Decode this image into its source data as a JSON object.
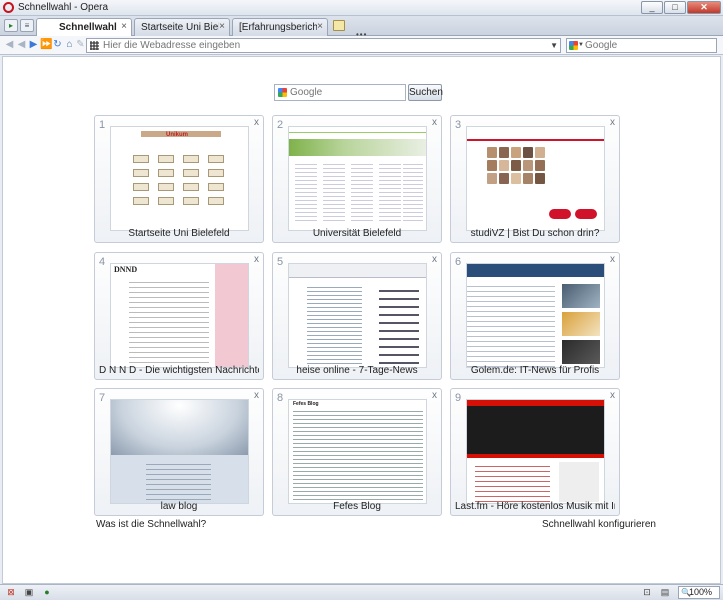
{
  "window": {
    "title": "Schnellwahl - Opera",
    "buttons": {
      "minimize": "_",
      "maximize": "□",
      "close": "✕"
    }
  },
  "tabs": [
    {
      "label": "Schnellwahl",
      "active": true
    },
    {
      "label": "Startseite Uni Bielefeld",
      "active": false
    },
    {
      "label": "[Erfahrungsbericht] Wel...",
      "active": false
    }
  ],
  "tab_close_glyph": "×",
  "tab_dots": "•••",
  "navigation": {
    "address_placeholder": "Hier die Webadresse eingeben",
    "search_engine_placeholder": "Google"
  },
  "speed_dial": {
    "search_placeholder": "Google",
    "search_button": "Suchen",
    "close_glyph": "x",
    "dials": [
      {
        "number": "1",
        "label": "Startseite Uni Bielefeld"
      },
      {
        "number": "2",
        "label": "Universität Bielefeld"
      },
      {
        "number": "3",
        "label": "studiVZ | Bist Du schon drin?"
      },
      {
        "number": "4",
        "label": "D N N D - Die wichtigsten Nachrichten auf ei..."
      },
      {
        "number": "5",
        "label": "heise online - 7-Tage-News"
      },
      {
        "number": "6",
        "label": "Golem.de: IT-News für Profis"
      },
      {
        "number": "7",
        "label": "law blog"
      },
      {
        "number": "8",
        "label": "Fefes Blog"
      },
      {
        "number": "9",
        "label": "Last.fm - Höre kostenlos Musik mit Internetra..."
      }
    ],
    "thumb_text": {
      "uni_logo": "Unikum",
      "dnnd_masthead": "DNND",
      "fefe_title": "Fefes Blog"
    },
    "help_link": "Was ist die Schnellwahl?",
    "configure_link": "Schnellwahl konfigurieren"
  },
  "statusbar": {
    "zoom": "100%"
  },
  "colors": {
    "opera_red": "#c8121d",
    "studivz_red": "#d0122a",
    "lastfm_red": "#d51007"
  }
}
